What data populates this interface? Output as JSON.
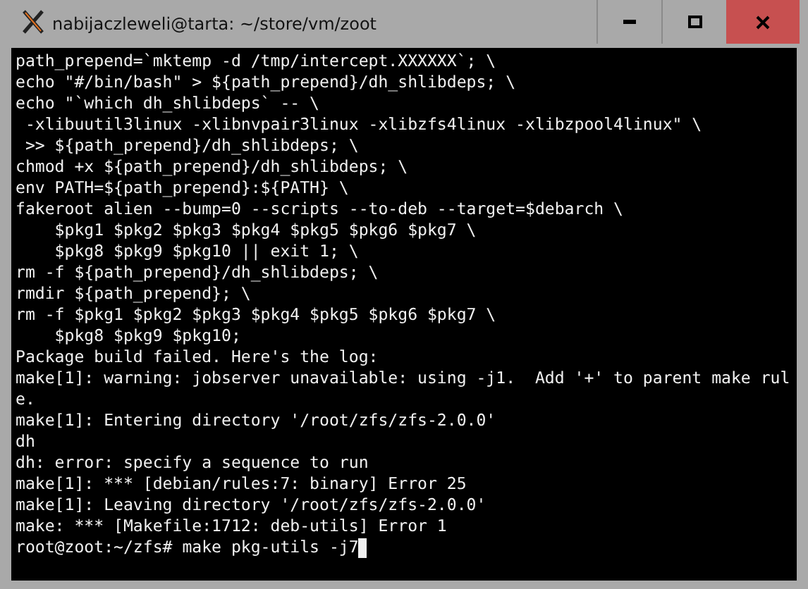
{
  "window": {
    "title": "nabijaczleweli@tarta: ~/store/vm/zoot"
  },
  "terminal": {
    "lines": [
      "path_prepend=`mktemp -d /tmp/intercept.XXXXXX`; \\",
      "echo \"#/bin/bash\" > ${path_prepend}/dh_shlibdeps; \\",
      "echo \"`which dh_shlibdeps` -- \\",
      " -xlibuutil3linux -xlibnvpair3linux -xlibzfs4linux -xlibzpool4linux\" \\",
      " >> ${path_prepend}/dh_shlibdeps; \\",
      "chmod +x ${path_prepend}/dh_shlibdeps; \\",
      "env PATH=${path_prepend}:${PATH} \\",
      "fakeroot alien --bump=0 --scripts --to-deb --target=$debarch \\",
      "    $pkg1 $pkg2 $pkg3 $pkg4 $pkg5 $pkg6 $pkg7 \\",
      "    $pkg8 $pkg9 $pkg10 || exit 1; \\",
      "rm -f ${path_prepend}/dh_shlibdeps; \\",
      "rmdir ${path_prepend}; \\",
      "rm -f $pkg1 $pkg2 $pkg3 $pkg4 $pkg5 $pkg6 $pkg7 \\",
      "    $pkg8 $pkg9 $pkg10;",
      "Package build failed. Here's the log:",
      "make[1]: warning: jobserver unavailable: using -j1.  Add '+' to parent make rul",
      "e.",
      "make[1]: Entering directory '/root/zfs/zfs-2.0.0'",
      "dh",
      "dh: error: specify a sequence to run",
      "make[1]: *** [debian/rules:7: binary] Error 25",
      "make[1]: Leaving directory '/root/zfs/zfs-2.0.0'",
      "make: *** [Makefile:1712: deb-utils] Error 1"
    ],
    "prompt": "root@zoot:~/zfs# ",
    "command": "make pkg-utils -j7"
  }
}
